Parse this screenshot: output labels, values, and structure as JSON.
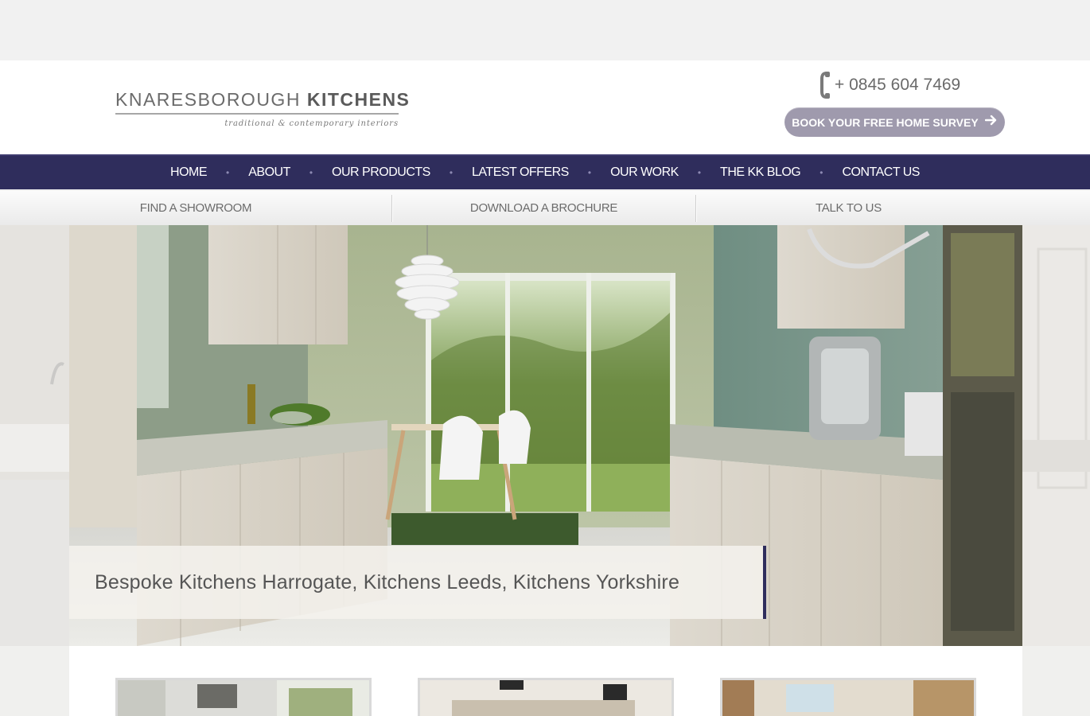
{
  "header": {
    "logo": {
      "name_light": "KNARESBOROUGH",
      "name_bold": "KITCHENS",
      "tagline": "traditional & contemporary interiors"
    },
    "phone": "+ 0845 604 7469",
    "survey_button": "BOOK YOUR FREE HOME SURVEY"
  },
  "nav": {
    "items": [
      {
        "label": "HOME"
      },
      {
        "label": "ABOUT"
      },
      {
        "label": "OUR PRODUCTS"
      },
      {
        "label": "LATEST OFFERS"
      },
      {
        "label": "OUR WORK"
      },
      {
        "label": "THE KK BLOG"
      },
      {
        "label": "CONTACT US"
      }
    ]
  },
  "subnav": {
    "items": [
      {
        "label": "FIND A SHOWROOM"
      },
      {
        "label": "DOWNLOAD A BROCHURE"
      },
      {
        "label": "TALK TO US"
      }
    ]
  },
  "hero": {
    "caption": "Bespoke Kitchens Harrogate, Kitchens Leeds, Kitchens Yorkshire"
  },
  "colors": {
    "nav_bg": "#2f2d5c",
    "button_bg": "#9f9aad",
    "accent": "#2f2d5c"
  },
  "icons": [
    "phone-icon",
    "arrow-right-icon"
  ]
}
